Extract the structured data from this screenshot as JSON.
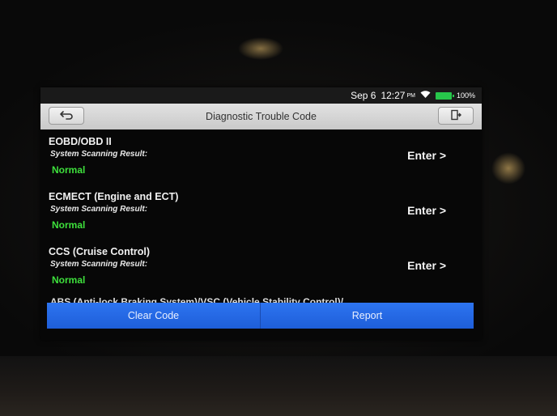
{
  "status_bar": {
    "date": "Sep 6",
    "time": "12:27",
    "ampm": "PM",
    "battery_percent": "100%",
    "icons": [
      "wifi-icon",
      "battery-icon"
    ],
    "battery_color": "#27c64b"
  },
  "header": {
    "title": "Diagnostic Trouble Code",
    "back_icon": "back-arrow-icon",
    "exit_icon": "exit-icon"
  },
  "systems": [
    {
      "name": "EOBD/OBD II",
      "subtitle": "System Scanning Result:",
      "result": "Normal",
      "action": "Enter >"
    },
    {
      "name": "ECMECT (Engine and ECT)",
      "subtitle": "System Scanning Result:",
      "result": "Normal",
      "action": "Enter >"
    },
    {
      "name": "CCS (Cruise Control)",
      "subtitle": "System Scanning Result:",
      "result": "Normal",
      "action": "Enter >"
    }
  ],
  "partial_item": "ABS (Anti-lock Braking System)/VSC (Vehicle Stability Control)/",
  "footer": {
    "clear_label": "Clear Code",
    "report_label": "Report",
    "accent": "#2569e8"
  },
  "colors": {
    "result_green": "#3ee03c",
    "screen_bg": "#070707"
  }
}
